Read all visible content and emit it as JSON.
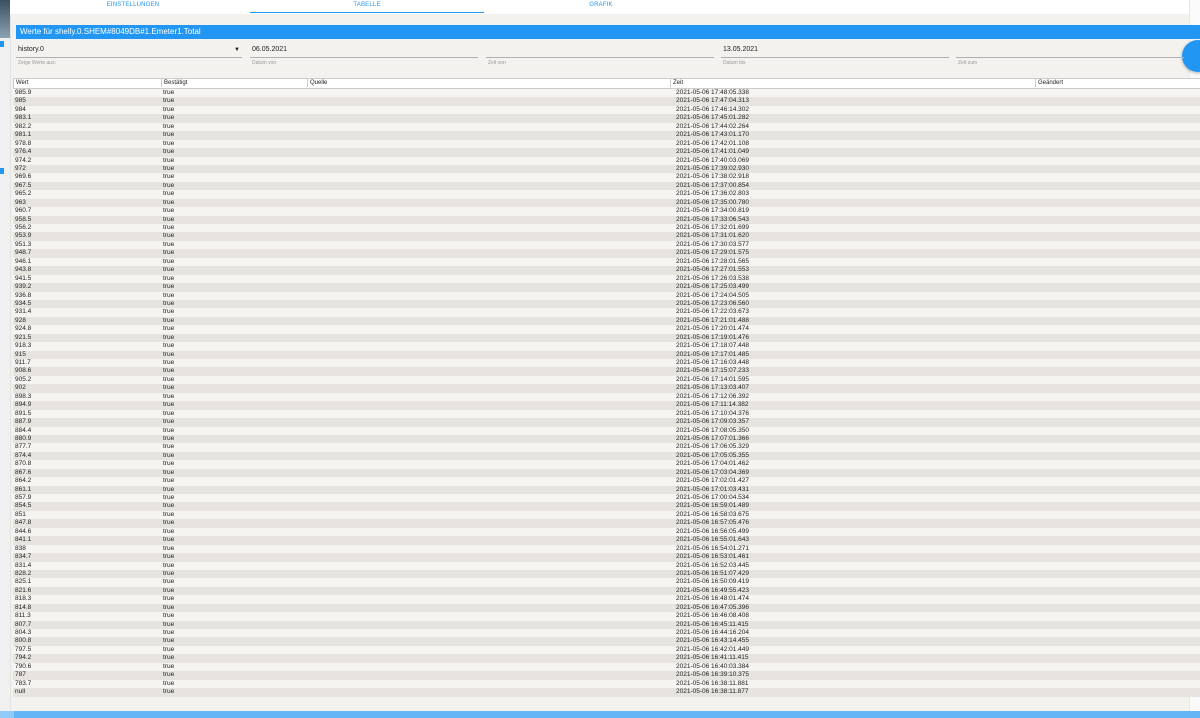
{
  "tabs": [
    {
      "label": "EINSTELLUNGEN",
      "active": false
    },
    {
      "label": "TABELLE",
      "active": true
    },
    {
      "label": "GRAFIK",
      "active": false
    }
  ],
  "title": "Werte für shelly.0.SHEM#8049DB#1.Emeter1.Total",
  "filters": {
    "instance": {
      "value": "history.0",
      "hint": "Zeige Werte aus:"
    },
    "date_from": {
      "value": "06.05.2021",
      "hint": "Datum von"
    },
    "time_from": {
      "value": "",
      "hint": "Zeit von"
    },
    "date_to": {
      "value": "13.05.2021",
      "hint": "Datum bis"
    },
    "time_to": {
      "value": "",
      "hint": "Zeit zum"
    }
  },
  "table": {
    "columns": [
      "Wert",
      "Bestätigt",
      "Quelle",
      "Zeit",
      "Geändert"
    ],
    "rows": [
      [
        "985.9",
        "true",
        "",
        "2021-05-06 17:48:05.338",
        ""
      ],
      [
        "985",
        "true",
        "",
        "2021-05-06 17:47:04.313",
        ""
      ],
      [
        "984",
        "true",
        "",
        "2021-05-06 17:46:14.302",
        ""
      ],
      [
        "983.1",
        "true",
        "",
        "2021-05-06 17:45:01.282",
        ""
      ],
      [
        "982.2",
        "true",
        "",
        "2021-05-06 17:44:02.264",
        ""
      ],
      [
        "981.1",
        "true",
        "",
        "2021-05-06 17:43:01.170",
        ""
      ],
      [
        "978.8",
        "true",
        "",
        "2021-05-06 17:42:01.108",
        ""
      ],
      [
        "976.4",
        "true",
        "",
        "2021-05-06 17:41:01.049",
        ""
      ],
      [
        "974.2",
        "true",
        "",
        "2021-05-06 17:40:03.069",
        ""
      ],
      [
        "972",
        "true",
        "",
        "2021-05-06 17:39:02.930",
        ""
      ],
      [
        "969.6",
        "true",
        "",
        "2021-05-06 17:38:02.918",
        ""
      ],
      [
        "967.5",
        "true",
        "",
        "2021-05-06 17:37:00.854",
        ""
      ],
      [
        "965.2",
        "true",
        "",
        "2021-05-06 17:36:02.803",
        ""
      ],
      [
        "963",
        "true",
        "",
        "2021-05-06 17:35:00.780",
        ""
      ],
      [
        "960.7",
        "true",
        "",
        "2021-05-06 17:34:00.819",
        ""
      ],
      [
        "958.5",
        "true",
        "",
        "2021-05-06 17:33:06.543",
        ""
      ],
      [
        "956.2",
        "true",
        "",
        "2021-05-06 17:32:01.699",
        ""
      ],
      [
        "953.9",
        "true",
        "",
        "2021-05-06 17:31:01.620",
        ""
      ],
      [
        "951.3",
        "true",
        "",
        "2021-05-06 17:30:03.577",
        ""
      ],
      [
        "948.7",
        "true",
        "",
        "2021-05-06 17:29:01.575",
        ""
      ],
      [
        "946.1",
        "true",
        "",
        "2021-05-06 17:28:01.565",
        ""
      ],
      [
        "943.8",
        "true",
        "",
        "2021-05-06 17:27:01.553",
        ""
      ],
      [
        "941.5",
        "true",
        "",
        "2021-05-06 17:26:03.538",
        ""
      ],
      [
        "939.2",
        "true",
        "",
        "2021-05-06 17:25:03.499",
        ""
      ],
      [
        "936.8",
        "true",
        "",
        "2021-05-06 17:24:04.505",
        ""
      ],
      [
        "934.5",
        "true",
        "",
        "2021-05-06 17:23:06.560",
        ""
      ],
      [
        "931.4",
        "true",
        "",
        "2021-05-06 17:22:03.673",
        ""
      ],
      [
        "928",
        "true",
        "",
        "2021-05-06 17:21:01.488",
        ""
      ],
      [
        "924.8",
        "true",
        "",
        "2021-05-06 17:20:01.474",
        ""
      ],
      [
        "921.5",
        "true",
        "",
        "2021-05-06 17:19:01.476",
        ""
      ],
      [
        "918.3",
        "true",
        "",
        "2021-05-06 17:18:07.448",
        ""
      ],
      [
        "915",
        "true",
        "",
        "2021-05-06 17:17:01.485",
        ""
      ],
      [
        "911.7",
        "true",
        "",
        "2021-05-06 17:16:03.448",
        ""
      ],
      [
        "908.6",
        "true",
        "",
        "2021-05-06 17:15:07.233",
        ""
      ],
      [
        "905.2",
        "true",
        "",
        "2021-05-06 17:14:01.595",
        ""
      ],
      [
        "902",
        "true",
        "",
        "2021-05-06 17:13:03.407",
        ""
      ],
      [
        "898.3",
        "true",
        "",
        "2021-05-06 17:12:06.392",
        ""
      ],
      [
        "894.9",
        "true",
        "",
        "2021-05-06 17:11:14.382",
        ""
      ],
      [
        "891.5",
        "true",
        "",
        "2021-05-06 17:10:04.376",
        ""
      ],
      [
        "887.9",
        "true",
        "",
        "2021-05-06 17:09:03.357",
        ""
      ],
      [
        "884.4",
        "true",
        "",
        "2021-05-06 17:08:05.350",
        ""
      ],
      [
        "880.9",
        "true",
        "",
        "2021-05-06 17:07:01.366",
        ""
      ],
      [
        "877.7",
        "true",
        "",
        "2021-05-06 17:06:05.329",
        ""
      ],
      [
        "874.4",
        "true",
        "",
        "2021-05-06 17:05:05.355",
        ""
      ],
      [
        "870.8",
        "true",
        "",
        "2021-05-06 17:04:01.462",
        ""
      ],
      [
        "867.6",
        "true",
        "",
        "2021-05-06 17:03:04.369",
        ""
      ],
      [
        "864.2",
        "true",
        "",
        "2021-05-06 17:02:01.427",
        ""
      ],
      [
        "861.1",
        "true",
        "",
        "2021-05-06 17:01:03.431",
        ""
      ],
      [
        "857.9",
        "true",
        "",
        "2021-05-06 17:00:04.534",
        ""
      ],
      [
        "854.5",
        "true",
        "",
        "2021-05-06 16:59:01.489",
        ""
      ],
      [
        "851",
        "true",
        "",
        "2021-05-06 16:58:03.675",
        ""
      ],
      [
        "847.8",
        "true",
        "",
        "2021-05-06 16:57:05.476",
        ""
      ],
      [
        "844.6",
        "true",
        "",
        "2021-05-06 16:56:05.499",
        ""
      ],
      [
        "841.1",
        "true",
        "",
        "2021-05-06 16:55:01.643",
        ""
      ],
      [
        "838",
        "true",
        "",
        "2021-05-06 16:54:01.271",
        ""
      ],
      [
        "834.7",
        "true",
        "",
        "2021-05-06 16:53:01.461",
        ""
      ],
      [
        "831.4",
        "true",
        "",
        "2021-05-06 16:52:03.445",
        ""
      ],
      [
        "828.2",
        "true",
        "",
        "2021-05-06 16:51:07.429",
        ""
      ],
      [
        "825.1",
        "true",
        "",
        "2021-05-06 16:50:09.419",
        ""
      ],
      [
        "821.6",
        "true",
        "",
        "2021-05-06 16:49:55.423",
        ""
      ],
      [
        "818.3",
        "true",
        "",
        "2021-05-06 16:48:01.474",
        ""
      ],
      [
        "814.8",
        "true",
        "",
        "2021-05-06 16:47:05.396",
        ""
      ],
      [
        "811.3",
        "true",
        "",
        "2021-05-06 16:46:08.408",
        ""
      ],
      [
        "807.7",
        "true",
        "",
        "2021-05-06 16:45:11.415",
        ""
      ],
      [
        "804.3",
        "true",
        "",
        "2021-05-06 16:44:16.204",
        ""
      ],
      [
        "800.8",
        "true",
        "",
        "2021-05-06 16:43:14.455",
        ""
      ],
      [
        "797.5",
        "true",
        "",
        "2021-05-06 16:42:01.449",
        ""
      ],
      [
        "794.2",
        "true",
        "",
        "2021-05-06 16:41:11.415",
        ""
      ],
      [
        "790.6",
        "true",
        "",
        "2021-05-06 16:40:03.384",
        ""
      ],
      [
        "787",
        "true",
        "",
        "2021-05-06 16:39:10.375",
        ""
      ],
      [
        "783.7",
        "true",
        "",
        "2021-05-06 16:38:11.881",
        ""
      ],
      [
        "null",
        "true",
        "",
        "2021-05-06 16:38:11.877",
        ""
      ]
    ]
  },
  "colors": {
    "accent": "#2196f3",
    "row_odd": "#f6f4f1",
    "row_even": "#e7e4e0"
  }
}
